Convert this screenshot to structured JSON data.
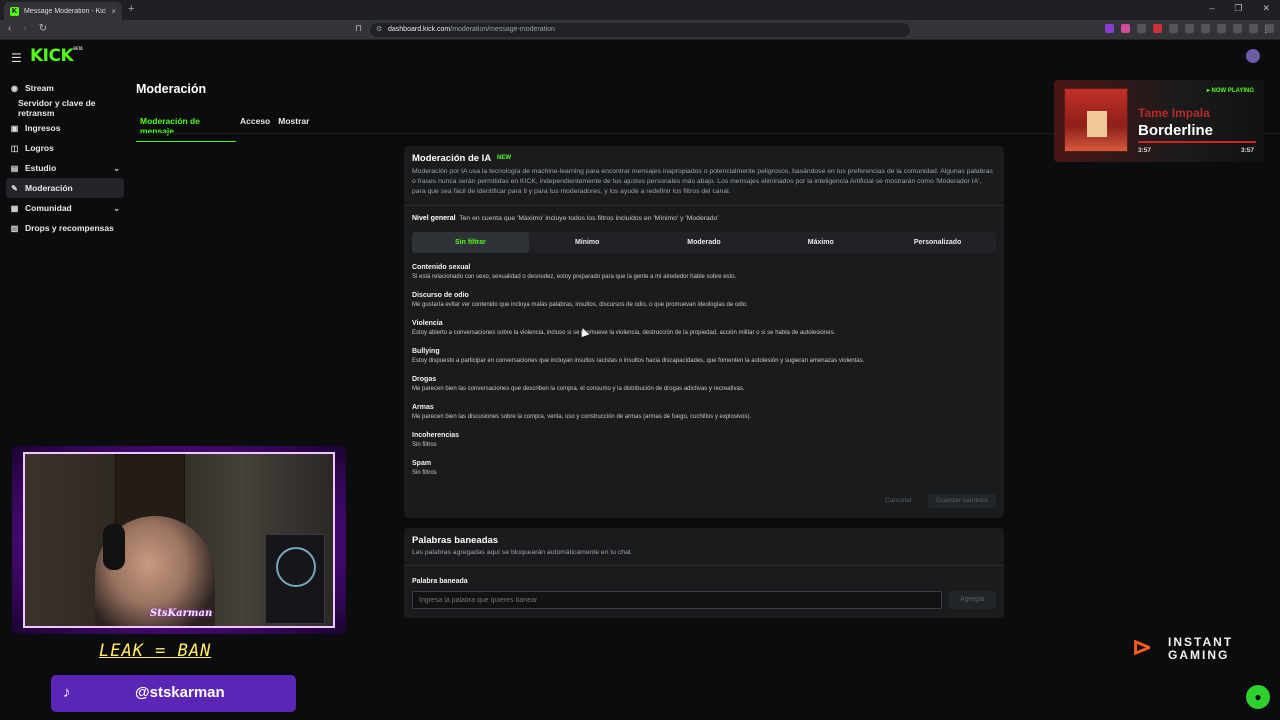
{
  "browser": {
    "tab_title": "Message Moderation - Kick Das",
    "tab_close": "×",
    "new_tab": "+",
    "url_host": "dashboard.kick.com",
    "url_path": "/moderation/message-moderation"
  },
  "header": {
    "logo": "KICK",
    "logo_badge": "BETA"
  },
  "sidebar": {
    "items": [
      {
        "label": "Stream",
        "icon": "stream-icon"
      },
      {
        "label": "Servidor y clave de retransm",
        "icon": ""
      },
      {
        "label": "Ingresos",
        "icon": "money-icon"
      },
      {
        "label": "Logros",
        "icon": "trophy-icon"
      },
      {
        "label": "Estudio",
        "icon": "studio-icon"
      },
      {
        "label": "Moderación",
        "icon": "wrench-icon"
      },
      {
        "label": "Comunidad",
        "icon": "community-icon"
      },
      {
        "label": "Drops y recompensas",
        "icon": "gift-icon"
      }
    ]
  },
  "page": {
    "title": "Moderación",
    "tabs": [
      "Moderación de mensaje",
      "Acceso",
      "Mostrar"
    ]
  },
  "ai": {
    "title": "Moderación de IA",
    "badge": "NEW",
    "description": "Moderación por IA usa la tecnología de machine-learning para encontrar mensajes inapropiados o potencialmente peligrosos, basándose en tus preferencias de la comunidad. Algunas palabras o frases nunca serán permitidas en KICK, independientemente de tus ajustes personales más abajo. Los mensajes eliminados por la inteligencia Artificial se mostrarán como 'Moderador IA', para que sea fácil de identificar para ti y para tus moderadores, y los ayude a redefinir los filtros del canal.",
    "level_label": "Nivel general",
    "level_hint": "Ten en cuenta que 'Máximo' incluye todos los filtros incluidos en 'Mínimo' y 'Moderado'",
    "levels": [
      "Sin filtrar",
      "Mínimo",
      "Moderado",
      "Máximo",
      "Personalizado"
    ],
    "selected_level": "Sin filtrar",
    "categories": [
      {
        "name": "Contenido sexual",
        "desc": "Si está relacionado con sexo, sexualidad o desnudez, estoy preparado para que la gente a mi alrededor hable sobre esto."
      },
      {
        "name": "Discurso de odio",
        "desc": "Me gustaría evitar ver contenido que incluya malas palabras, insultos, discursos de odio, o que promuevan ideologías de odio."
      },
      {
        "name": "Violencia",
        "desc": "Estoy abierto a conversaciones sobre la violencia, incluso si se promueve la violencia, destrucción de la propiedad, acción militar o si se habla de autolesiones."
      },
      {
        "name": "Bullying",
        "desc": "Estoy dispuesto a participar en conversaciones que incluyan insultos racistas o insultos hacia discapacidades, que fomenten la autolesión y sugieran amenazas violentas."
      },
      {
        "name": "Drogas",
        "desc": "Me parecen bien las conversaciones que describen la compra, el consumo y la distribución de drogas adictivas y recreativas."
      },
      {
        "name": "Armas",
        "desc": "Me parecen bien las discusiones sobre la compra, venta, uso y construcción de armas (armas de fuego, cuchillos y explosivos)."
      },
      {
        "name": "Incoherencias",
        "desc": "Sin filtros"
      },
      {
        "name": "Spam",
        "desc": "Sin filtros"
      }
    ],
    "cancel": "Cancelar",
    "save": "Guardar cambios"
  },
  "banned": {
    "title": "Palabras baneadas",
    "description": "Las palabras agregadas aquí se bloquearán automáticamente en tu chat.",
    "field_label": "Palabra baneada",
    "placeholder": "Ingresa la palabra que quieres banear",
    "add": "Agregar"
  },
  "now_playing": {
    "tag": "NOW PLAYING",
    "artist": "Tame Impala",
    "song": "Borderline",
    "elapsed": "3:57",
    "total": "3:57"
  },
  "stream_overlay": {
    "cam_name": "StsKarman",
    "banner": "LEAK = BAN",
    "tiktok": "@stskarman",
    "sponsor": "INSTANT GAMING"
  },
  "colors": {
    "accent": "#53fc18",
    "panel": "#191b1d",
    "background": "#0b0c0d",
    "tiktok": "#5b25b6"
  }
}
